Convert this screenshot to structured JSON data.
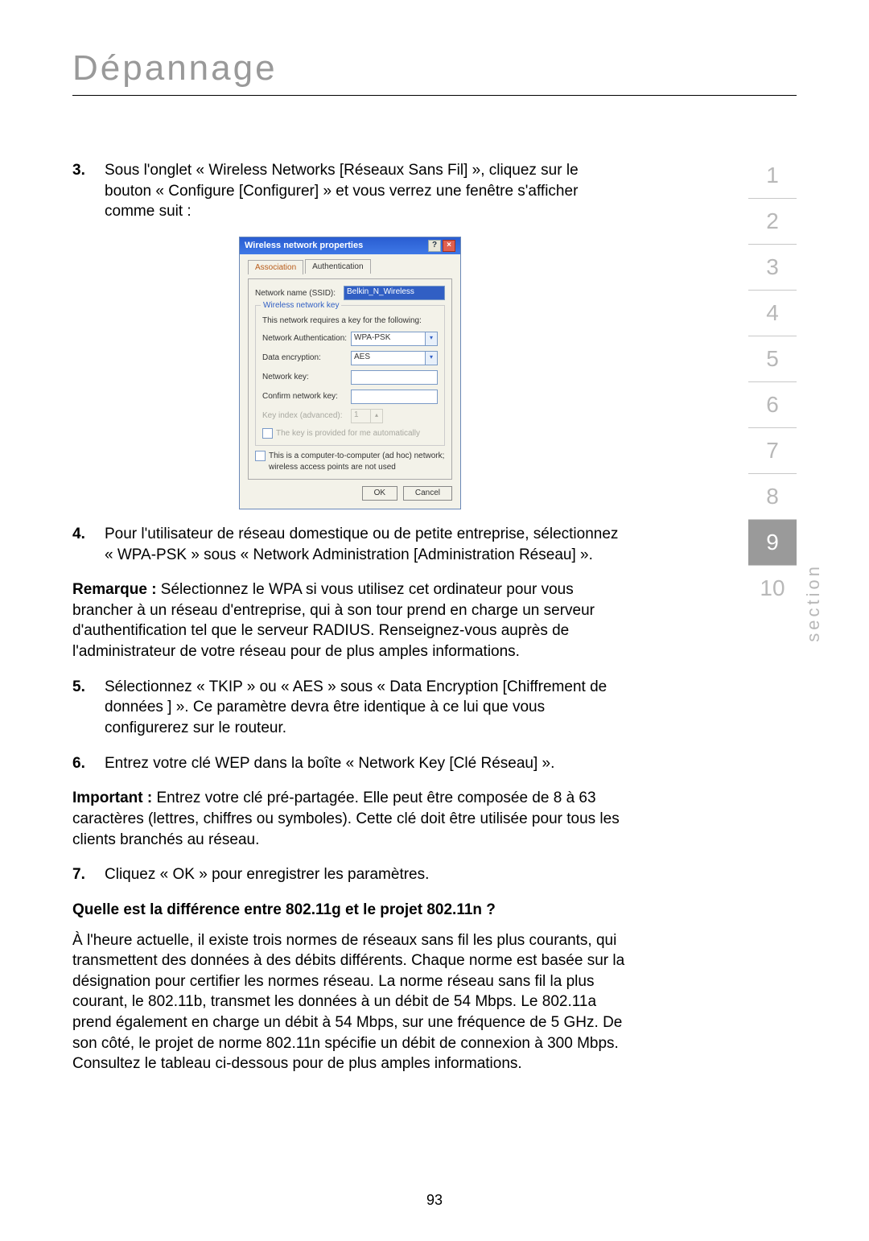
{
  "title": "Dépannage",
  "page_number": "93",
  "section_label": "section",
  "section_numbers": [
    "1",
    "2",
    "3",
    "4",
    "5",
    "6",
    "7",
    "8",
    "9",
    "10"
  ],
  "active_section": "9",
  "items": {
    "i3_num": "3.",
    "i3_txt": "Sous l'onglet « Wireless Networks [Réseaux Sans Fil] », cliquez sur le bouton « Configure [Configurer] » et vous verrez une fenêtre s'afficher comme suit :",
    "i4_num": "4.",
    "i4_txt": "Pour l'utilisateur de réseau domestique ou de petite entreprise, sélectionnez « WPA-PSK » sous « Network Administration [Administration Réseau] ».",
    "remarque_label": "Remarque :",
    "remarque_txt": " Sélectionnez le WPA si vous utilisez cet ordinateur pour vous brancher à un réseau d'entreprise, qui à son tour prend en charge un serveur d'authentification tel que le serveur RADIUS. Renseignez-vous auprès de l'administrateur de votre réseau pour de plus amples informations.",
    "i5_num": "5.",
    "i5_txt": "Sélectionnez « TKIP » ou « AES » sous « Data Encryption [Chiffrement de données ] ». Ce paramètre devra être identique à ce lui que vous configurerez sur le routeur.",
    "i6_num": "6.",
    "i6_txt": "Entrez votre clé WEP dans la boîte « Network Key [Clé Réseau] ».",
    "important_label": "Important :",
    "important_txt": "  Entrez votre clé pré-partagée. Elle peut être composée de 8 à 63 caractères (lettres, chiffres ou symboles). Cette clé doit être utilisée pour tous les clients branchés au réseau.",
    "i7_num": "7.",
    "i7_txt": "Cliquez « OK » pour enregistrer les paramètres.",
    "subheading": "Quelle est la différence entre 802.11g et le projet 802.11n ?",
    "body2": "À l'heure actuelle, il existe trois normes de réseaux sans fil les plus courants, qui transmettent des données à des débits différents. Chaque norme est basée sur la désignation pour certifier les normes réseau. La norme réseau sans fil la plus courant, le 802.11b, transmet les données à un débit de 54 Mbps. Le 802.11a prend également en charge un débit à 54 Mbps, sur une fréquence de 5 GHz. De son côté, le projet de norme 802.11n spécifie un débit de connexion à 300 Mbps. Consultez le tableau ci-dessous pour de plus amples informations."
  },
  "dialog": {
    "title": "Wireless network properties",
    "help": "?",
    "close": "×",
    "tab_assoc": "Association",
    "tab_auth": "Authentication",
    "lbl_ssid": "Network name (SSID):",
    "val_ssid": "Belkin_N_Wireless",
    "frame_legend": "Wireless network key",
    "note": "This network requires a key for the following:",
    "lbl_auth": "Network Authentication:",
    "val_auth": "WPA-PSK",
    "lbl_enc": "Data encryption:",
    "val_enc": "AES",
    "lbl_key": "Network key:",
    "lbl_conf": "Confirm network key:",
    "lbl_idx": "Key index (advanced):",
    "val_idx": "1",
    "chk_auto": "The key is provided for me automatically",
    "chk_adhoc": "This is a computer-to-computer (ad hoc) network; wireless access points are not used",
    "btn_ok": "OK",
    "btn_cancel": "Cancel"
  }
}
